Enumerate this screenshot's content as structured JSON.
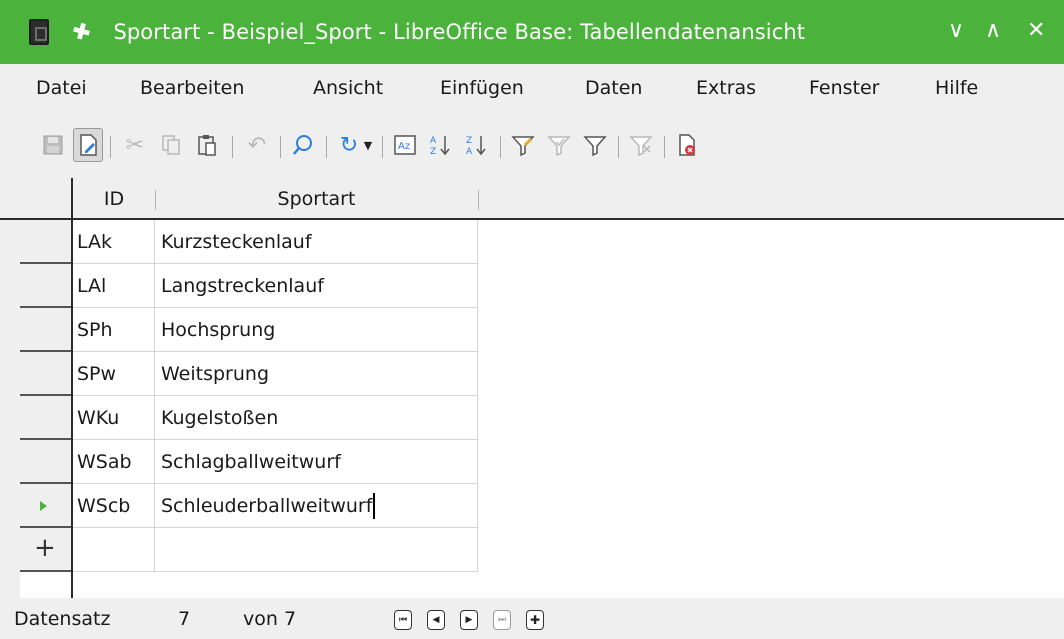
{
  "window": {
    "title": "Sportart - Beispiel_Sport - LibreOffice Base: Tabellendatenansicht",
    "minimize_glyph": "∨",
    "maximize_glyph": "∧",
    "close_glyph": "✕"
  },
  "menu": [
    "Datei",
    "Bearbeiten",
    "Ansicht",
    "Einfügen",
    "Daten",
    "Extras",
    "Fenster",
    "Hilfe"
  ],
  "toolbar": {
    "icons": [
      "save-icon",
      "edit-mode-icon",
      "cut-icon",
      "copy-icon",
      "paste-icon",
      "undo-icon",
      "find-icon",
      "refresh-icon",
      "dropdown-icon",
      "sort-icon",
      "sort-ascending-icon",
      "sort-descending-icon",
      "autofilter-icon",
      "apply-filter-icon",
      "standard-filter-icon",
      "reset-filter-icon",
      "delete-record-icon"
    ]
  },
  "grid": {
    "columns": [
      "ID",
      "Sportart"
    ],
    "rows": [
      {
        "id": "LAk",
        "sportart": "Kurzsteckenlauf"
      },
      {
        "id": "LAl",
        "sportart": "Langstreckenlauf"
      },
      {
        "id": "SPh",
        "sportart": "Hochsprung"
      },
      {
        "id": "SPw",
        "sportart": "Weitsprung"
      },
      {
        "id": "WKu",
        "sportart": "Kugelstoßen"
      },
      {
        "id": "WSab",
        "sportart": "Schlagballweitwurf"
      },
      {
        "id": "WScb",
        "sportart": "Schleuderballweitwurf"
      }
    ],
    "current_row_marker": "▸",
    "new_row_marker": "+"
  },
  "status": {
    "record_label": "Datensatz",
    "record_number": "7",
    "of_label": "von 7"
  },
  "colors": {
    "titlebar": "#4bb33c",
    "accent": "#4bb33c"
  }
}
